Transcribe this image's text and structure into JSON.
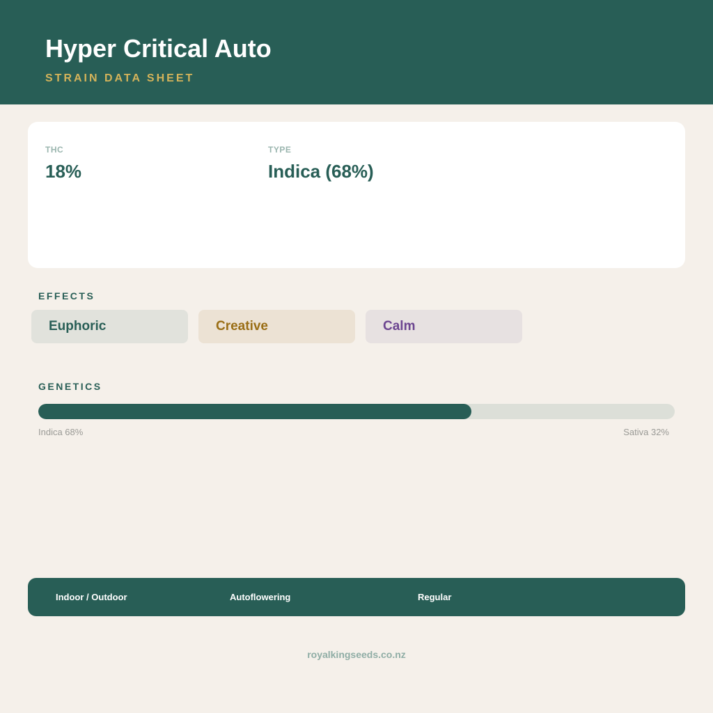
{
  "header": {
    "title": "Hyper Critical Auto",
    "subtitle": "STRAIN DATA SHEET"
  },
  "stats": {
    "thc": {
      "label": "THC",
      "value": "18%"
    },
    "type": {
      "label": "TYPE",
      "value": "Indica (68%)"
    }
  },
  "effects": {
    "label": "EFFECTS",
    "items": [
      "Euphoric",
      "Creative",
      "Calm"
    ]
  },
  "genetics": {
    "label": "GENETICS",
    "indica_percent": 68,
    "left_label": "Indica 68%",
    "right_label": "Sativa 32%"
  },
  "footer": {
    "items": [
      "Indoor / Outdoor",
      "Autoflowering",
      "Regular"
    ],
    "website": "royalkingseeds.co.nz"
  },
  "colors": {
    "brand": "#285e56",
    "accent": "#d4b35a",
    "background": "#f5f0ea"
  }
}
